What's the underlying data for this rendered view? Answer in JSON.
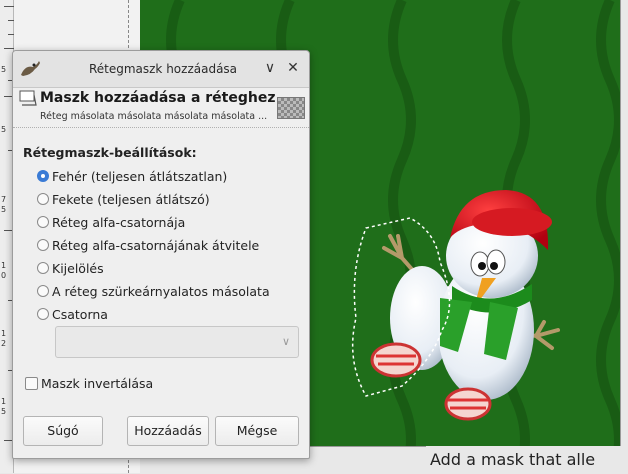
{
  "ruler": {
    "labels": [
      "5",
      "5",
      "7",
      "5",
      "1",
      "0",
      "1",
      "2",
      "1",
      "5"
    ]
  },
  "dialog": {
    "window_title": "Rétegmaszk hozzáadása",
    "minimize_glyph": "∨",
    "close_glyph": "✕",
    "header_title": "Maszk hozzáadása a réteghez",
    "header_subtitle": "Réteg másolata másolata másolata másolata ...",
    "section_label": "Rétegmaszk-beállítások:",
    "options": [
      {
        "label": "Fehér (teljesen átlátszatlan)",
        "checked": true
      },
      {
        "label": "Fekete (teljesen átlátszó)",
        "checked": false
      },
      {
        "label": "Réteg alfa-csatornája",
        "checked": false
      },
      {
        "label": "Réteg alfa-csatornájának átvitele",
        "checked": false
      },
      {
        "label": "Kijelölés",
        "checked": false
      },
      {
        "label": "A réteg szürkeárnyalatos másolata",
        "checked": false
      },
      {
        "label": "Csatorna",
        "checked": false
      }
    ],
    "channel_select_value": "",
    "invert_label": "Maszk invertálása",
    "invert_checked": false,
    "buttons": {
      "help": "Súgó",
      "add": "Hozzáadás",
      "cancel": "Mégse"
    }
  },
  "tooltip": {
    "text": "Add a mask that alle"
  },
  "colors": {
    "canvas_green": "#1f6e1a",
    "radio_accent": "#3a7bd5"
  }
}
